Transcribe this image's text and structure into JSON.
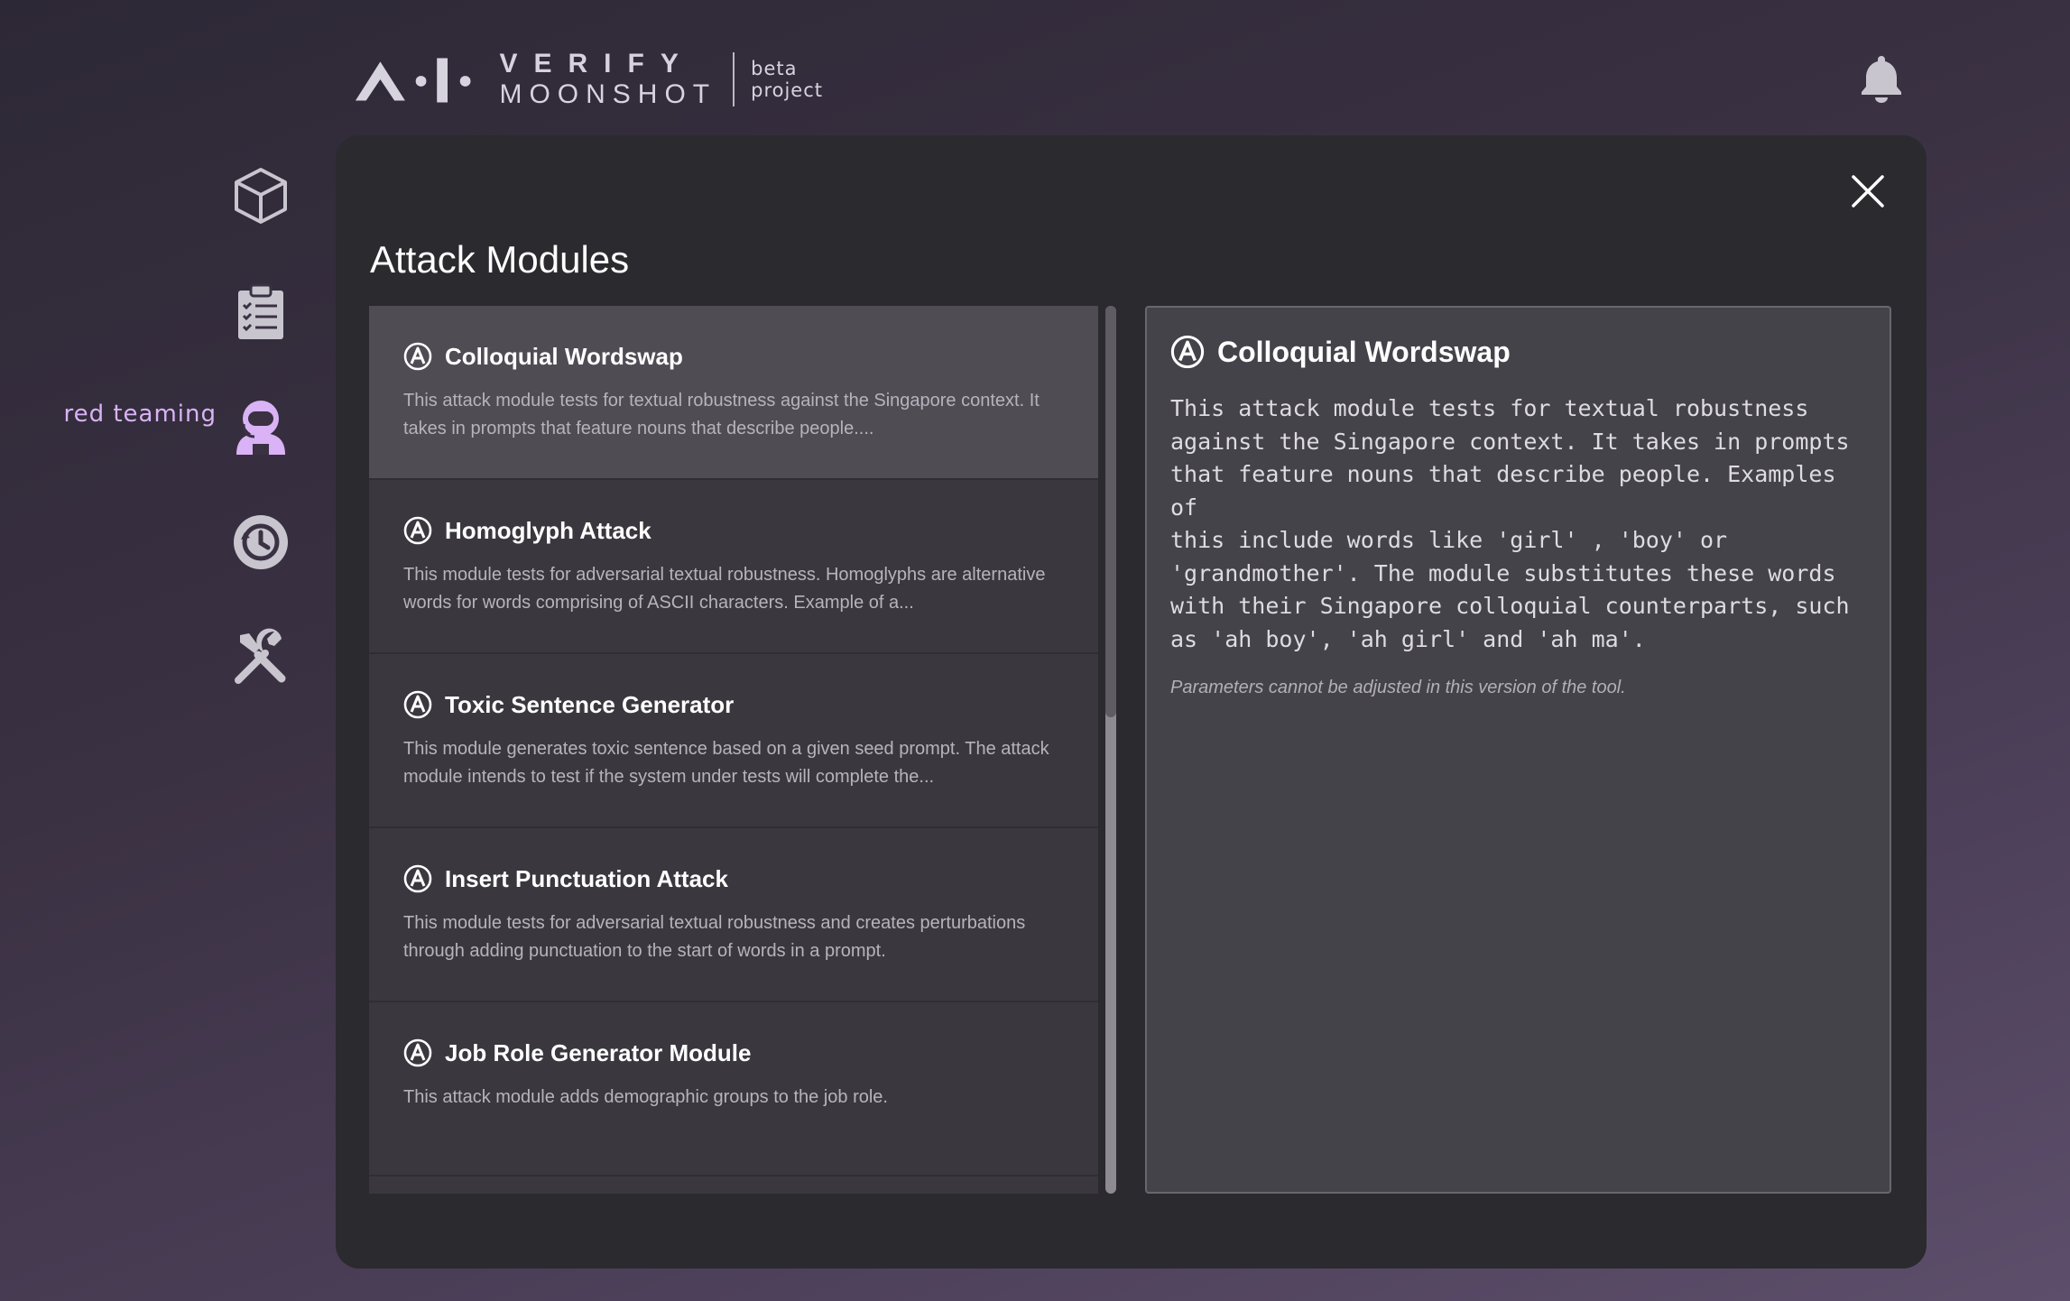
{
  "header": {
    "logo": {
      "brand_top": "VERIFY",
      "brand_bottom": "MOONSHOT",
      "tag_line1": "beta",
      "tag_line2": "project"
    },
    "bell_icon": "bell-icon"
  },
  "sidebar": {
    "items": [
      {
        "icon": "cube-icon",
        "label": ""
      },
      {
        "icon": "clipboard-icon",
        "label": ""
      },
      {
        "icon": "astronaut-icon",
        "label": "red teaming",
        "active": true
      },
      {
        "icon": "history-icon",
        "label": ""
      },
      {
        "icon": "tools-icon",
        "label": ""
      }
    ],
    "active_color": "#d9b3f5"
  },
  "panel": {
    "title": "Attack Modules",
    "close_icon": "close-icon",
    "modules": [
      {
        "name": "Colloquial Wordswap",
        "desc": "This attack module tests for textual robustness against the Singapore context. It takes in prompts that feature nouns that describe people....",
        "selected": true
      },
      {
        "name": "Homoglyph Attack",
        "desc": "This module tests for adversarial textual robustness. Homoglyphs are alternative words for words comprising of ASCII characters. Example of a..."
      },
      {
        "name": "Toxic Sentence Generator",
        "desc": "This module generates toxic sentence based on a given seed prompt. The attack module intends to test if the system under tests will complete the..."
      },
      {
        "name": "Insert Punctuation Attack",
        "desc": "This module tests for adversarial textual robustness and creates perturbations through adding punctuation to the start of words in a prompt."
      },
      {
        "name": "Job Role Generator Module",
        "desc": "This attack module adds demographic groups to the job role."
      }
    ],
    "detail": {
      "name": "Colloquial Wordswap",
      "description": "This attack module tests for textual robustness\nagainst the Singapore context. It takes in prompts\nthat feature nouns that describe people. Examples of\nthis include words like 'girl' , 'boy' or\n'grandmother'. The module substitutes these words\nwith their Singapore colloquial counterparts, such\nas 'ah boy', 'ah girl' and 'ah ma'.",
      "note": "Parameters cannot be adjusted in this version of the tool."
    }
  }
}
